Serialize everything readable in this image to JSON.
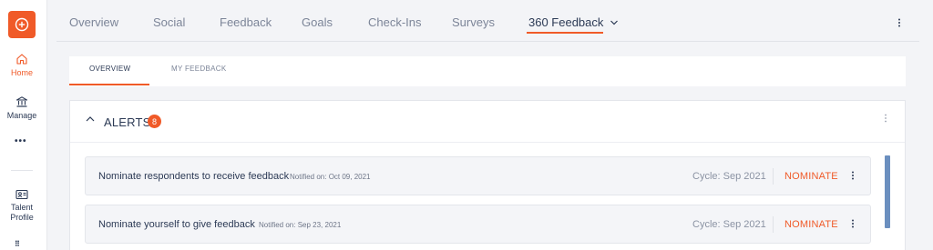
{
  "sidebar": {
    "home_label": "Home",
    "manage_label": "Manage",
    "talent_profile_label": "Talent Profile"
  },
  "topnav": {
    "tabs": [
      "Overview",
      "Social",
      "Feedback",
      "Goals",
      "Check-Ins",
      "Surveys",
      "360 Feedback"
    ],
    "active_tab": "360 Feedback"
  },
  "subtabs": {
    "items": [
      "OVERVIEW",
      "MY FEEDBACK"
    ],
    "active": "OVERVIEW"
  },
  "alerts": {
    "title": "ALERTS",
    "count": "8",
    "items": [
      {
        "title": "Nominate respondents to receive feedback",
        "notified": "Notified on: Oct 09, 2021",
        "cycle": "Cycle: Sep 2021",
        "action": "NOMINATE"
      },
      {
        "title": "Nominate yourself to give feedback",
        "notified": "Notified on: Sep 23, 2021",
        "cycle": "Cycle: Sep 2021",
        "action": "NOMINATE"
      }
    ]
  },
  "colors": {
    "accent": "#f05a28",
    "text": "#2c3a55",
    "muted": "#7c8598",
    "scroll": "#6b8fbf"
  }
}
